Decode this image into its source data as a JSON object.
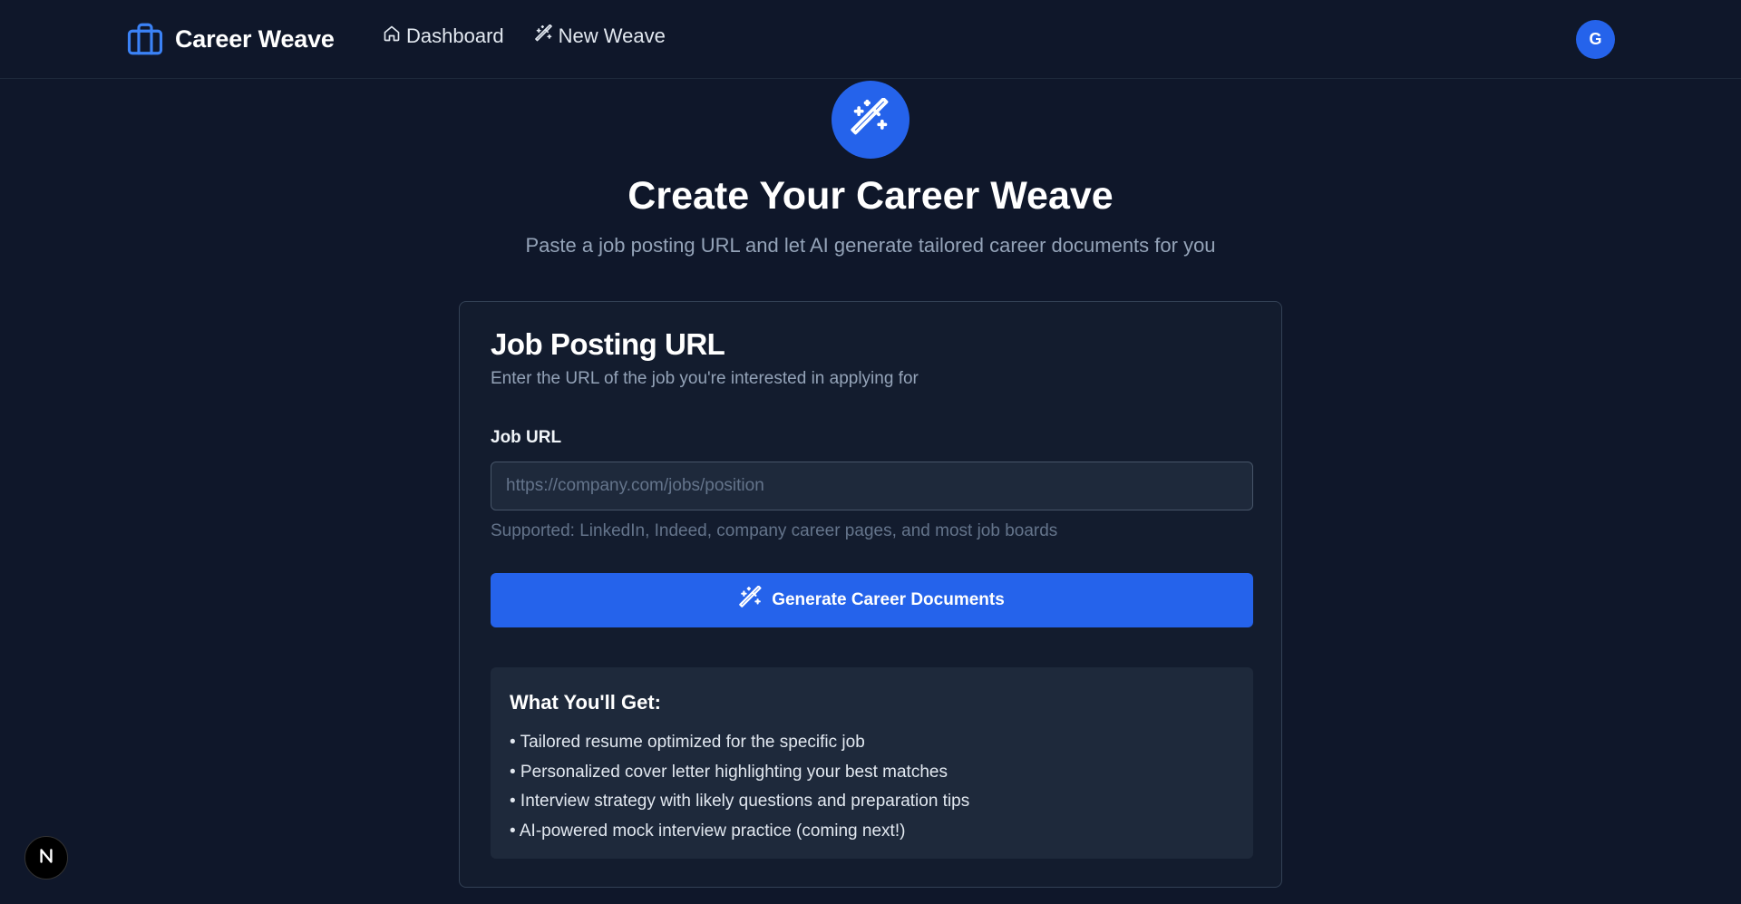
{
  "header": {
    "brand": "Career Weave",
    "nav": [
      {
        "label": "Dashboard",
        "icon": "home-icon"
      },
      {
        "label": "New Weave",
        "icon": "magic-wand-icon"
      }
    ],
    "avatar_initial": "G"
  },
  "hero": {
    "icon": "magic-wand-icon",
    "title": "Create Your Career Weave",
    "subtitle": "Paste a job posting URL and let AI generate tailored career documents for you"
  },
  "card": {
    "title": "Job Posting URL",
    "description": "Enter the URL of the job you're interested in applying for",
    "field_label": "Job URL",
    "input_value": "",
    "input_placeholder": "https://company.com/jobs/position",
    "hint": "Supported: LinkedIn, Indeed, company career pages, and most job boards",
    "button_label": "Generate Career Documents"
  },
  "info": {
    "title": "What You'll Get:",
    "items": [
      "• Tailored resume optimized for the specific job",
      "• Personalized cover letter highlighting your best matches",
      "• Interview strategy with likely questions and preparation tips",
      "• AI-powered mock interview practice (coming next!)"
    ]
  },
  "dev_badge": {
    "label": "N",
    "icon": "nextjs-icon"
  },
  "colors": {
    "background": "#0f172a",
    "card": "#131c2e",
    "accent": "#2563eb",
    "muted_text": "#94a3b8"
  }
}
